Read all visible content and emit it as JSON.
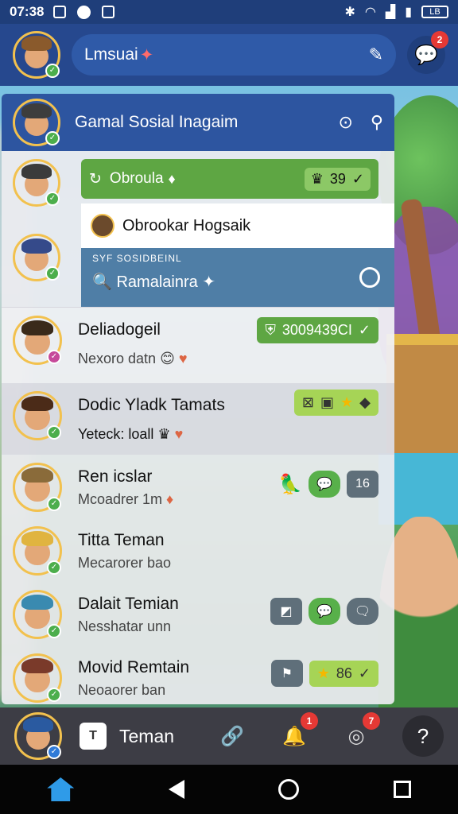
{
  "status_bar": {
    "time": "07:38",
    "battery": "LB"
  },
  "header": {
    "search_text": "Lmsuai",
    "sparkle": "✦",
    "chat_badge": "2"
  },
  "panel": {
    "title": "Gamal Sosial Inagaim"
  },
  "rows": [
    {
      "card_green_label": "Obroula",
      "card_green_value": "39",
      "card_white_label": "Obrookar Hogsaik",
      "card_blue_tag": "SYF SOSIDBEINL",
      "card_blue_label": "Ramalainra"
    },
    {
      "name": "Deliadogeil",
      "sub": "Nexoro datn",
      "pill_value": "3009439CI"
    },
    {
      "name": "Dodic Yladk Tamats",
      "sub": "Yeteck: loall"
    },
    {
      "name": "Ren icslar",
      "sub": "Mcoadrer 1m",
      "btn_text": "16"
    },
    {
      "name": "Titta Teman",
      "sub": "Mecarorer bao"
    },
    {
      "name": "Dalait Temian",
      "sub": "Nesshatar unn"
    },
    {
      "name": "Movid Remtain",
      "sub": "Neoaorer ban",
      "pill_value": "86"
    }
  ],
  "bottom_bar": {
    "tab_icon": "T",
    "tab_label": "Teman",
    "badge_1": "1",
    "badge_2": "7",
    "help": "?"
  },
  "colors": {
    "primary": "#26488e",
    "accent_green": "#5ea643",
    "badge_red": "#e53935"
  }
}
